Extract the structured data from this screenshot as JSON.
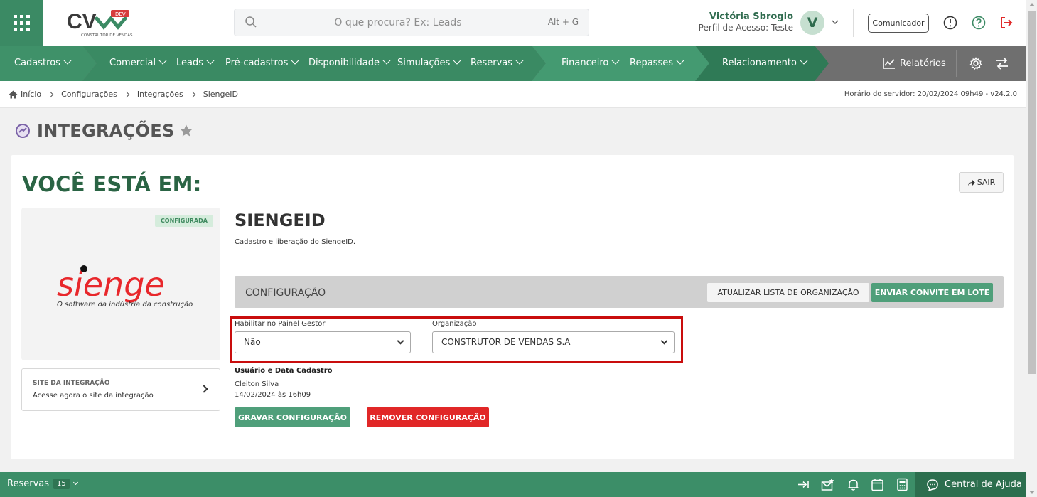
{
  "header": {
    "logo_text": "CV",
    "logo_badge": "DEV",
    "logo_sub": "CONSTRUTOR DE VENDAS",
    "search_placeholder": "O que procura? Ex: Leads",
    "search_shortcut": "Alt + G",
    "user_name": "Victória Sbrogio",
    "user_profile": "Perfil de Acesso: Teste",
    "avatar_initial": "V",
    "comunicador_label": "Comunicador",
    "icons": [
      "apps-grid-icon",
      "search-icon",
      "chevron-down-icon",
      "info-icon",
      "help-icon",
      "logout-icon"
    ]
  },
  "nav": {
    "items": [
      {
        "label": "Cadastros"
      },
      {
        "label": "Comercial"
      },
      {
        "label": "Leads"
      },
      {
        "label": "Pré-cadastros"
      },
      {
        "label": "Disponibilidade"
      },
      {
        "label": "Simulações"
      },
      {
        "label": "Reservas"
      },
      {
        "label": "Financeiro"
      },
      {
        "label": "Repasses"
      },
      {
        "label": "Relacionamento"
      }
    ],
    "reports_label": "Relatórios",
    "colors": {
      "dark": "#2f7a56",
      "mid": "#3f9169",
      "light": "#4f9f7a"
    }
  },
  "breadcrumb": {
    "items": [
      "Início",
      "Configurações",
      "Integrações",
      "SiengeID"
    ],
    "server_time": "Horário do servidor: 20/02/2024 09h49 - v24.2.0"
  },
  "page": {
    "title": "INTEGRAÇÕES",
    "you_are_here": "VOCÊ ESTÁ EM:",
    "exit_label": "SAIR"
  },
  "integration": {
    "status_badge": "CONFIGURADA",
    "logo_word": "sienge",
    "logo_tagline": "O software da indústria da construção",
    "site_title": "SITE DA INTEGRAÇÃO",
    "site_desc": "Acesse agora o site da integração",
    "name": "SIENGEID",
    "description": "Cadastro e liberação do SiengeID.",
    "config_label": "CONFIGURAÇÃO",
    "btn_update_org": "ATUALIZAR LISTA DE ORGANIZAÇÃO",
    "btn_invite": "ENVIAR CONVITE EM LOTE",
    "field_panel_label": "Habilitar no Painel Gestor",
    "field_panel_value": "Não",
    "field_org_label": "Organização",
    "field_org_value": "CONSTRUTOR DE VENDAS S.A",
    "meta_title": "Usuário e Data Cadastro",
    "meta_user": "Cleiton Silva",
    "meta_date": "14/02/2024 às 16h09",
    "btn_save": "GRAVAR CONFIGURAÇÃO",
    "btn_remove": "REMOVER CONFIGURAÇÃO"
  },
  "footer": {
    "reservas_label": "Reservas",
    "reservas_count": "15",
    "help_label": "Central de Ajuda"
  }
}
